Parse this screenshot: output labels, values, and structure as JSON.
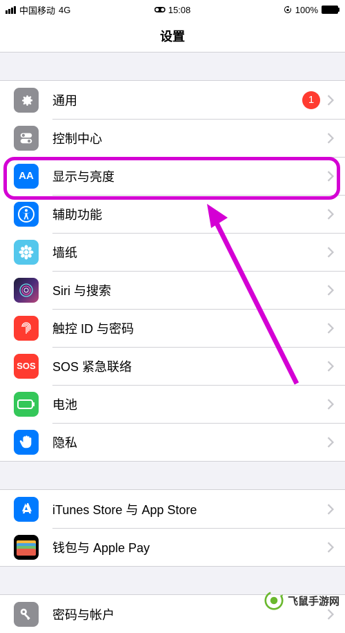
{
  "status": {
    "carrier": "中国移动",
    "network": "4G",
    "time": "15:08",
    "battery_pct": "100%"
  },
  "header": {
    "title": "设置"
  },
  "groups": [
    {
      "rows": [
        {
          "id": "general",
          "label": "通用",
          "badge": "1"
        },
        {
          "id": "control-center",
          "label": "控制中心"
        },
        {
          "id": "display",
          "label": "显示与亮度",
          "highlighted": true
        },
        {
          "id": "accessibility",
          "label": "辅助功能"
        },
        {
          "id": "wallpaper",
          "label": "墙纸"
        },
        {
          "id": "siri",
          "label": "Siri 与搜索"
        },
        {
          "id": "touchid",
          "label": "触控 ID 与密码"
        },
        {
          "id": "sos",
          "label": "SOS 紧急联络"
        },
        {
          "id": "battery",
          "label": "电池"
        },
        {
          "id": "privacy",
          "label": "隐私"
        }
      ]
    },
    {
      "rows": [
        {
          "id": "itunes",
          "label": "iTunes Store 与 App Store"
        },
        {
          "id": "wallet",
          "label": "钱包与 Apple Pay"
        }
      ]
    },
    {
      "rows": [
        {
          "id": "accounts",
          "label": "密码与帐户"
        }
      ]
    }
  ],
  "icon_text": {
    "display": "AA",
    "sos": "SOS"
  },
  "watermark": "飞鼠手游网"
}
